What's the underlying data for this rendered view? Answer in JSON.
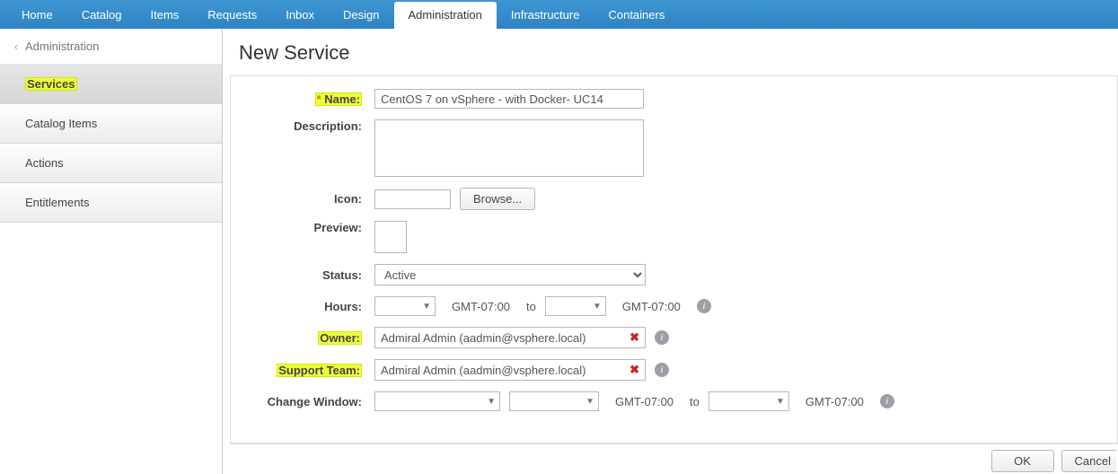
{
  "nav": {
    "tabs": [
      {
        "label": "Home"
      },
      {
        "label": "Catalog"
      },
      {
        "label": "Items"
      },
      {
        "label": "Requests"
      },
      {
        "label": "Inbox"
      },
      {
        "label": "Design"
      },
      {
        "label": "Administration",
        "active": true
      },
      {
        "label": "Infrastructure"
      },
      {
        "label": "Containers"
      }
    ]
  },
  "sidebar": {
    "breadcrumb": "Administration",
    "items": [
      {
        "label": "Services",
        "active": true,
        "highlighted": true
      },
      {
        "label": "Catalog Items"
      },
      {
        "label": "Actions"
      },
      {
        "label": "Entitlements"
      }
    ]
  },
  "page": {
    "title": "New Service"
  },
  "form": {
    "name": {
      "label": "Name:",
      "required": true,
      "highlighted": true,
      "value": "CentOS 7 on vSphere - with Docker- UC14"
    },
    "description": {
      "label": "Description:",
      "value": ""
    },
    "icon": {
      "label": "Icon:",
      "value": "",
      "browse_label": "Browse..."
    },
    "preview": {
      "label": "Preview:"
    },
    "status": {
      "label": "Status:",
      "value": "Active"
    },
    "hours": {
      "label": "Hours:",
      "from": "",
      "to": "",
      "tz": "GMT-07:00",
      "to_word": "to"
    },
    "owner": {
      "label": "Owner:",
      "highlighted": true,
      "value": "Admiral Admin (aadmin@vsphere.local)"
    },
    "support_team": {
      "label": "Support Team:",
      "highlighted": true,
      "value": "Admiral Admin (aadmin@vsphere.local)"
    },
    "change_window": {
      "label": "Change Window:",
      "tz": "GMT-07:00",
      "to_word": "to"
    }
  },
  "footer": {
    "ok": "OK",
    "cancel": "Cancel"
  }
}
